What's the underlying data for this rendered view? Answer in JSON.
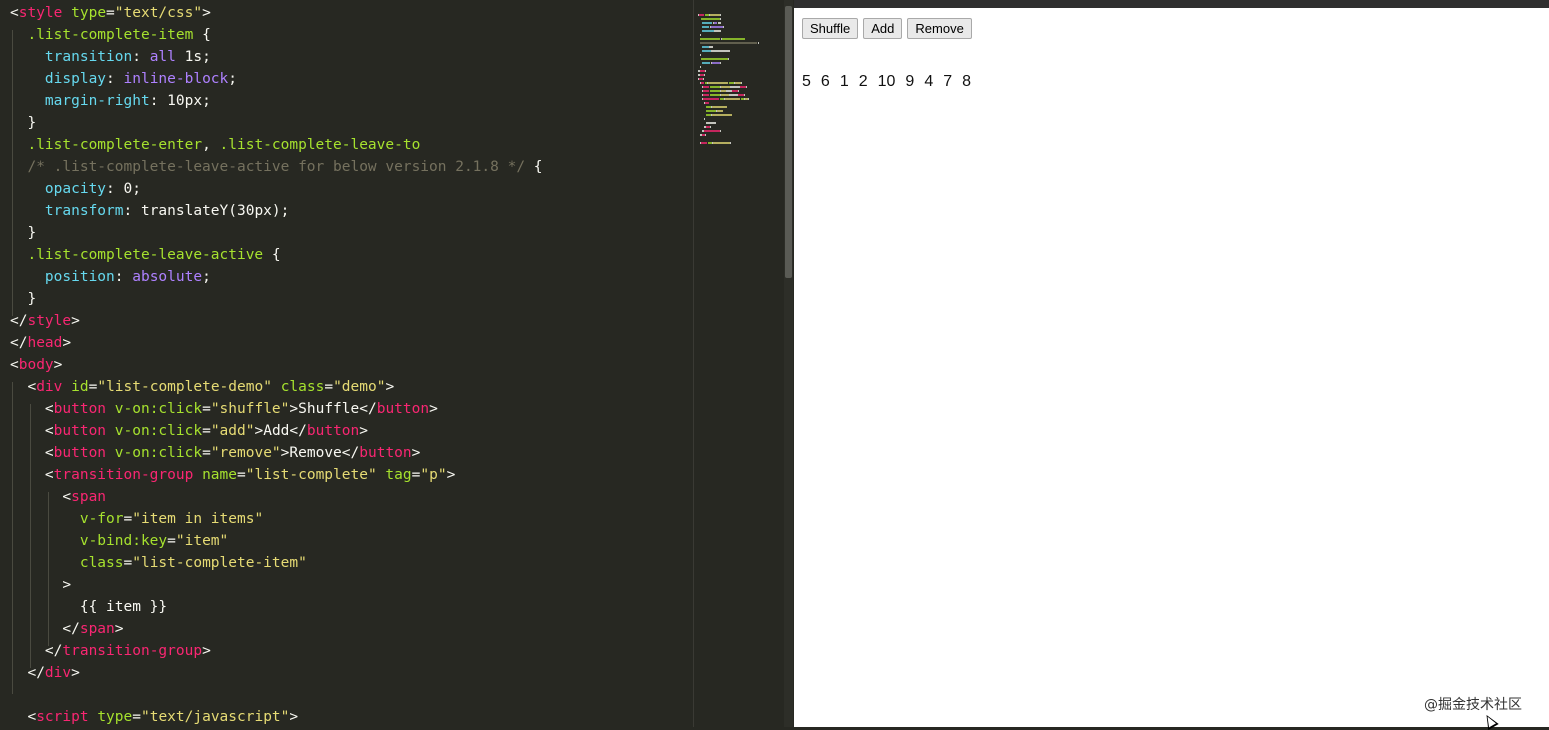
{
  "editor": {
    "lines": [
      [
        {
          "t": "<",
          "c": "#F8F8F2"
        },
        {
          "t": "style",
          "c": "#F92672"
        },
        {
          "t": " ",
          "c": "#F8F8F2"
        },
        {
          "t": "type",
          "c": "#A6E22E"
        },
        {
          "t": "=",
          "c": "#F8F8F2"
        },
        {
          "t": "\"text/css\"",
          "c": "#E6DB74"
        },
        {
          "t": ">",
          "c": "#F8F8F2"
        }
      ],
      [
        {
          "t": "  .list-complete-item ",
          "c": "#A6E22E"
        },
        {
          "t": "{",
          "c": "#F8F8F2"
        }
      ],
      [
        {
          "t": "    ",
          "c": "#F8F8F2"
        },
        {
          "t": "transition",
          "c": "#66D9EF"
        },
        {
          "t": ": ",
          "c": "#F8F8F2"
        },
        {
          "t": "all",
          "c": "#AE81FF"
        },
        {
          "t": " 1s;",
          "c": "#F8F8F2"
        }
      ],
      [
        {
          "t": "    ",
          "c": "#F8F8F2"
        },
        {
          "t": "display",
          "c": "#66D9EF"
        },
        {
          "t": ": ",
          "c": "#F8F8F2"
        },
        {
          "t": "inline-block",
          "c": "#AE81FF"
        },
        {
          "t": ";",
          "c": "#F8F8F2"
        }
      ],
      [
        {
          "t": "    ",
          "c": "#F8F8F2"
        },
        {
          "t": "margin-right",
          "c": "#66D9EF"
        },
        {
          "t": ": 10px;",
          "c": "#F8F8F2"
        }
      ],
      [
        {
          "t": "  }",
          "c": "#F8F8F2"
        }
      ],
      [
        {
          "t": "  .list-complete-enter",
          "c": "#A6E22E"
        },
        {
          "t": ", ",
          "c": "#F8F8F2"
        },
        {
          "t": ".list-complete-leave-to",
          "c": "#A6E22E"
        }
      ],
      [
        {
          "t": "  /* .list-complete-leave-active for below version 2.1.8 */",
          "c": "#75715E"
        },
        {
          "t": " {",
          "c": "#F8F8F2"
        }
      ],
      [
        {
          "t": "    ",
          "c": "#F8F8F2"
        },
        {
          "t": "opacity",
          "c": "#66D9EF"
        },
        {
          "t": ": 0;",
          "c": "#F8F8F2"
        }
      ],
      [
        {
          "t": "    ",
          "c": "#F8F8F2"
        },
        {
          "t": "transform",
          "c": "#66D9EF"
        },
        {
          "t": ": translateY(30px);",
          "c": "#F8F8F2"
        }
      ],
      [
        {
          "t": "  }",
          "c": "#F8F8F2"
        }
      ],
      [
        {
          "t": "  .list-complete-leave-active ",
          "c": "#A6E22E"
        },
        {
          "t": "{",
          "c": "#F8F8F2"
        }
      ],
      [
        {
          "t": "    ",
          "c": "#F8F8F2"
        },
        {
          "t": "position",
          "c": "#66D9EF"
        },
        {
          "t": ": ",
          "c": "#F8F8F2"
        },
        {
          "t": "absolute",
          "c": "#AE81FF"
        },
        {
          "t": ";",
          "c": "#F8F8F2"
        }
      ],
      [
        {
          "t": "  }",
          "c": "#F8F8F2"
        }
      ],
      [
        {
          "t": "</",
          "c": "#F8F8F2"
        },
        {
          "t": "style",
          "c": "#F92672"
        },
        {
          "t": ">",
          "c": "#F8F8F2"
        }
      ],
      [
        {
          "t": "</",
          "c": "#F8F8F2"
        },
        {
          "t": "head",
          "c": "#F92672"
        },
        {
          "t": ">",
          "c": "#F8F8F2"
        }
      ],
      [
        {
          "t": "<",
          "c": "#F8F8F2"
        },
        {
          "t": "body",
          "c": "#F92672"
        },
        {
          "t": ">",
          "c": "#F8F8F2"
        }
      ],
      [
        {
          "t": "  <",
          "c": "#F8F8F2"
        },
        {
          "t": "div",
          "c": "#F92672"
        },
        {
          "t": " ",
          "c": "#F8F8F2"
        },
        {
          "t": "id",
          "c": "#A6E22E"
        },
        {
          "t": "=",
          "c": "#F8F8F2"
        },
        {
          "t": "\"list-complete-demo\"",
          "c": "#E6DB74"
        },
        {
          "t": " ",
          "c": "#F8F8F2"
        },
        {
          "t": "class",
          "c": "#A6E22E"
        },
        {
          "t": "=",
          "c": "#F8F8F2"
        },
        {
          "t": "\"demo\"",
          "c": "#E6DB74"
        },
        {
          "t": ">",
          "c": "#F8F8F2"
        }
      ],
      [
        {
          "t": "    <",
          "c": "#F8F8F2"
        },
        {
          "t": "button",
          "c": "#F92672"
        },
        {
          "t": " ",
          "c": "#F8F8F2"
        },
        {
          "t": "v-on:click",
          "c": "#A6E22E"
        },
        {
          "t": "=",
          "c": "#F8F8F2"
        },
        {
          "t": "\"shuffle\"",
          "c": "#E6DB74"
        },
        {
          "t": ">Shuffle</",
          "c": "#F8F8F2"
        },
        {
          "t": "button",
          "c": "#F92672"
        },
        {
          "t": ">",
          "c": "#F8F8F2"
        }
      ],
      [
        {
          "t": "    <",
          "c": "#F8F8F2"
        },
        {
          "t": "button",
          "c": "#F92672"
        },
        {
          "t": " ",
          "c": "#F8F8F2"
        },
        {
          "t": "v-on:click",
          "c": "#A6E22E"
        },
        {
          "t": "=",
          "c": "#F8F8F2"
        },
        {
          "t": "\"add\"",
          "c": "#E6DB74"
        },
        {
          "t": ">Add</",
          "c": "#F8F8F2"
        },
        {
          "t": "button",
          "c": "#F92672"
        },
        {
          "t": ">",
          "c": "#F8F8F2"
        }
      ],
      [
        {
          "t": "    <",
          "c": "#F8F8F2"
        },
        {
          "t": "button",
          "c": "#F92672"
        },
        {
          "t": " ",
          "c": "#F8F8F2"
        },
        {
          "t": "v-on:click",
          "c": "#A6E22E"
        },
        {
          "t": "=",
          "c": "#F8F8F2"
        },
        {
          "t": "\"remove\"",
          "c": "#E6DB74"
        },
        {
          "t": ">Remove</",
          "c": "#F8F8F2"
        },
        {
          "t": "button",
          "c": "#F92672"
        },
        {
          "t": ">",
          "c": "#F8F8F2"
        }
      ],
      [
        {
          "t": "    <",
          "c": "#F8F8F2"
        },
        {
          "t": "transition-group",
          "c": "#F92672"
        },
        {
          "t": " ",
          "c": "#F8F8F2"
        },
        {
          "t": "name",
          "c": "#A6E22E"
        },
        {
          "t": "=",
          "c": "#F8F8F2"
        },
        {
          "t": "\"list-complete\"",
          "c": "#E6DB74"
        },
        {
          "t": " ",
          "c": "#F8F8F2"
        },
        {
          "t": "tag",
          "c": "#A6E22E"
        },
        {
          "t": "=",
          "c": "#F8F8F2"
        },
        {
          "t": "\"p\"",
          "c": "#E6DB74"
        },
        {
          "t": ">",
          "c": "#F8F8F2"
        }
      ],
      [
        {
          "t": "      <",
          "c": "#F8F8F2"
        },
        {
          "t": "span",
          "c": "#F92672"
        }
      ],
      [
        {
          "t": "        ",
          "c": "#F8F8F2"
        },
        {
          "t": "v-for",
          "c": "#A6E22E"
        },
        {
          "t": "=",
          "c": "#F8F8F2"
        },
        {
          "t": "\"item in items\"",
          "c": "#E6DB74"
        }
      ],
      [
        {
          "t": "        ",
          "c": "#F8F8F2"
        },
        {
          "t": "v-bind:key",
          "c": "#A6E22E"
        },
        {
          "t": "=",
          "c": "#F8F8F2"
        },
        {
          "t": "\"item\"",
          "c": "#E6DB74"
        }
      ],
      [
        {
          "t": "        ",
          "c": "#F8F8F2"
        },
        {
          "t": "class",
          "c": "#A6E22E"
        },
        {
          "t": "=",
          "c": "#F8F8F2"
        },
        {
          "t": "\"list-complete-item\"",
          "c": "#E6DB74"
        }
      ],
      [
        {
          "t": "      >",
          "c": "#F8F8F2"
        }
      ],
      [
        {
          "t": "        {{ item }}",
          "c": "#F8F8F2"
        }
      ],
      [
        {
          "t": "      </",
          "c": "#F8F8F2"
        },
        {
          "t": "span",
          "c": "#F92672"
        },
        {
          "t": ">",
          "c": "#F8F8F2"
        }
      ],
      [
        {
          "t": "    </",
          "c": "#F8F8F2"
        },
        {
          "t": "transition-group",
          "c": "#F92672"
        },
        {
          "t": ">",
          "c": "#F8F8F2"
        }
      ],
      [
        {
          "t": "  </",
          "c": "#F8F8F2"
        },
        {
          "t": "div",
          "c": "#F92672"
        },
        {
          "t": ">",
          "c": "#F8F8F2"
        }
      ],
      [
        {
          "t": "",
          "c": "#F8F8F2"
        }
      ],
      [
        {
          "t": "  <",
          "c": "#F8F8F2"
        },
        {
          "t": "script",
          "c": "#F92672"
        },
        {
          "t": " ",
          "c": "#F8F8F2"
        },
        {
          "t": "type",
          "c": "#A6E22E"
        },
        {
          "t": "=",
          "c": "#F8F8F2"
        },
        {
          "t": "\"text/javascript\"",
          "c": "#E6DB74"
        },
        {
          "t": ">",
          "c": "#F8F8F2"
        }
      ]
    ]
  },
  "browser": {
    "buttons": {
      "shuffle": "Shuffle",
      "add": "Add",
      "remove": "Remove"
    },
    "items": [
      "5",
      "6",
      "1",
      "2",
      "10",
      "9",
      "4",
      "7",
      "8"
    ],
    "watermark": "@掘金技术社区"
  }
}
